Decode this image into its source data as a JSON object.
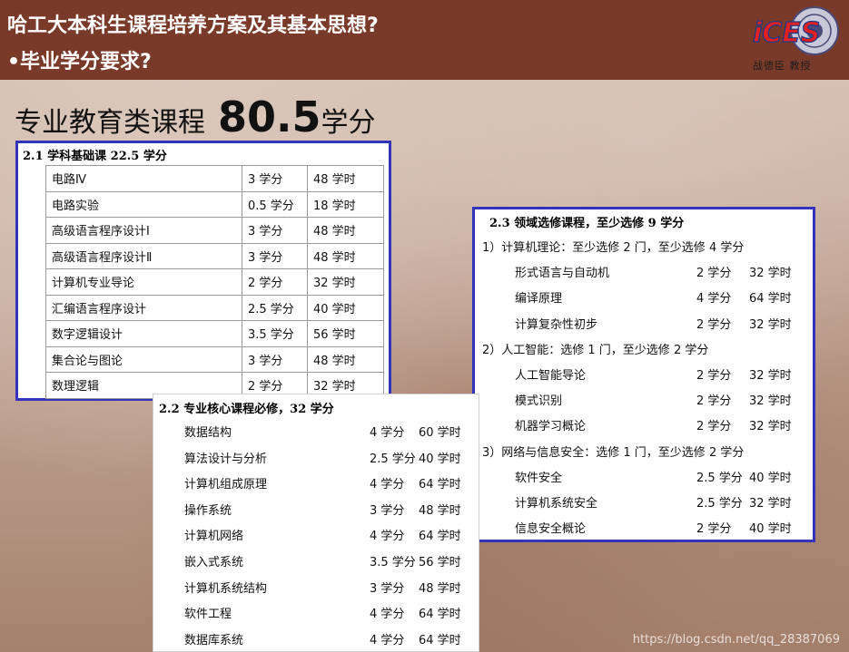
{
  "header": {
    "line1": "哈工大本科生课程培养方案及其基本思想?",
    "line2": "•毕业学分要求?",
    "bg_color": "#7a3a2a",
    "logo": {
      "text": "iCES",
      "caption": "战德臣 教授"
    }
  },
  "main_title": {
    "prefix": "专业教育类课程",
    "number": "80.5",
    "suffix": "学分"
  },
  "section_21": {
    "title": "2.1  学科基础课  22.5 学分",
    "rows": [
      {
        "name": "电路Ⅳ",
        "credits": "3 学分",
        "hours": "48 学时"
      },
      {
        "name": "电路实验",
        "credits": "0.5 学分",
        "hours": "18 学时"
      },
      {
        "name": "高级语言程序设计Ⅰ",
        "credits": "3 学分",
        "hours": "48 学时"
      },
      {
        "name": "高级语言程序设计Ⅱ",
        "credits": "3 学分",
        "hours": "48 学时"
      },
      {
        "name": "计算机专业导论",
        "credits": "2 学分",
        "hours": "32 学时"
      },
      {
        "name": "汇编语言程序设计",
        "credits": "2.5 学分",
        "hours": "40 学时"
      },
      {
        "name": "数字逻辑设计",
        "credits": "3.5 学分",
        "hours": "56 学时"
      },
      {
        "name": "集合论与图论",
        "credits": "3 学分",
        "hours": "48 学时"
      },
      {
        "name": "数理逻辑",
        "credits": "2 学分",
        "hours": "32 学时"
      }
    ]
  },
  "section_22": {
    "title": "2.2  专业核心课程必修，32 学分",
    "rows": [
      {
        "name": "数据结构",
        "credits": "4  学分",
        "hours": "60 学时"
      },
      {
        "name": "算法设计与分析",
        "credits": "2.5 学分",
        "hours": "40 学时"
      },
      {
        "name": "计算机组成原理",
        "credits": "4 学分",
        "hours": "64 学时"
      },
      {
        "name": "操作系统",
        "credits": "3 学分",
        "hours": "48 学时"
      },
      {
        "name": "计算机网络",
        "credits": "4 学分",
        "hours": "64 学时"
      },
      {
        "name": "嵌入式系统",
        "credits": "3.5 学分",
        "hours": "56 学时"
      },
      {
        "name": "计算机系统结构",
        "credits": "3 学分",
        "hours": "48 学时"
      },
      {
        "name": "软件工程",
        "credits": "4 学分",
        "hours": "64 学时"
      },
      {
        "name": "数据库系统",
        "credits": "4 学分",
        "hours": "64 学时"
      }
    ]
  },
  "section_23": {
    "title": "2.3  领域选修课程，至少选修 9 学分",
    "categories": [
      {
        "label": "1）计算机理论：至少选修 2 门，至少选修 4 学分",
        "rows": [
          {
            "name": "形式语言与自动机",
            "credits": "2 学分",
            "hours": "32 学时"
          },
          {
            "name": "编译原理",
            "credits": "4 学分",
            "hours": "64 学时"
          },
          {
            "name": "计算复杂性初步",
            "credits": "2 学分",
            "hours": "32 学时"
          }
        ]
      },
      {
        "label": "2）人工智能：选修 1 门，至少选修 2 学分",
        "rows": [
          {
            "name": "人工智能导论",
            "credits": "2 学分",
            "hours": "32 学时"
          },
          {
            "name": "模式识别",
            "credits": "2 学分",
            "hours": "32 学时"
          },
          {
            "name": "机器学习概论",
            "credits": "2 学分",
            "hours": "32 学时"
          }
        ]
      },
      {
        "label": "3）网络与信息安全：选修 1 门，至少选修 2 学分",
        "rows": [
          {
            "name": "软件安全",
            "credits": "2.5 学分",
            "hours": "40 学时"
          },
          {
            "name": "计算机系统安全",
            "credits": "2.5 学分",
            "hours": "32 学时"
          },
          {
            "name": "信息安全概论",
            "credits": "2 学分",
            "hours": "40 学时"
          }
        ]
      }
    ]
  },
  "watermark": "https://blog.csdn.net/qq_28387069"
}
